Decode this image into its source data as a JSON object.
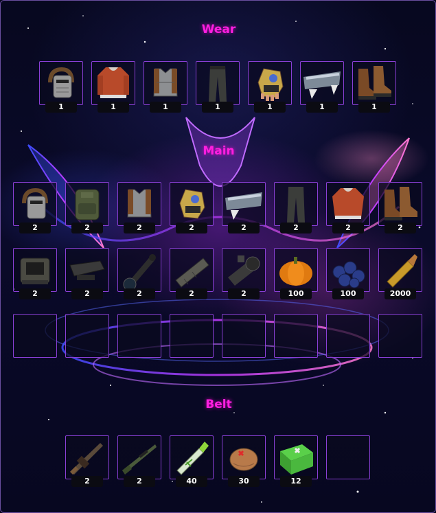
{
  "wear": {
    "title": "Wear",
    "items": [
      {
        "icon": "metal-facemask-icon",
        "qty": "1"
      },
      {
        "icon": "hoodie-icon",
        "qty": "1"
      },
      {
        "icon": "chestplate-icon",
        "qty": "1"
      },
      {
        "icon": "pants-icon",
        "qty": "1"
      },
      {
        "icon": "gloves-icon",
        "qty": "1"
      },
      {
        "icon": "kilt-icon",
        "qty": "1"
      },
      {
        "icon": "boots-icon",
        "qty": "1"
      }
    ]
  },
  "main": {
    "title": "Main",
    "rows": [
      [
        {
          "icon": "metal-facemask-icon",
          "qty": "2"
        },
        {
          "icon": "backpack-icon",
          "qty": "2"
        },
        {
          "icon": "chestplate-icon",
          "qty": "2"
        },
        {
          "icon": "gloves-icon",
          "qty": "2"
        },
        {
          "icon": "kilt-icon",
          "qty": "2"
        },
        {
          "icon": "pants-icon",
          "qty": "2"
        },
        {
          "icon": "hoodie-icon",
          "qty": "2"
        },
        {
          "icon": "boots-icon",
          "qty": "2"
        }
      ],
      [
        {
          "icon": "holosight-icon",
          "qty": "2"
        },
        {
          "icon": "flashlight-attachment-icon",
          "qty": "2"
        },
        {
          "icon": "scope-icon",
          "qty": "2"
        },
        {
          "icon": "silencer-icon",
          "qty": "2"
        },
        {
          "icon": "night-scope-icon",
          "qty": "2"
        },
        {
          "icon": "pumpkin-icon",
          "qty": "100"
        },
        {
          "icon": "blueberries-icon",
          "qty": "100"
        },
        {
          "icon": "rifle-ammo-icon",
          "qty": "2000"
        }
      ],
      [
        {
          "icon": "",
          "qty": ""
        },
        {
          "icon": "",
          "qty": ""
        },
        {
          "icon": "",
          "qty": ""
        },
        {
          "icon": "",
          "qty": ""
        },
        {
          "icon": "",
          "qty": ""
        },
        {
          "icon": "",
          "qty": ""
        },
        {
          "icon": "",
          "qty": ""
        },
        {
          "icon": "",
          "qty": ""
        }
      ]
    ]
  },
  "belt": {
    "title": "Belt",
    "items": [
      {
        "icon": "assault-rifle-icon",
        "qty": "2"
      },
      {
        "icon": "bolt-rifle-icon",
        "qty": "2"
      },
      {
        "icon": "syringe-icon",
        "qty": "40"
      },
      {
        "icon": "bandage-icon",
        "qty": "30"
      },
      {
        "icon": "medkit-icon",
        "qty": "12"
      },
      {
        "icon": "",
        "qty": ""
      }
    ]
  },
  "colors": {
    "accent": "#ff1fe0",
    "slot_border": "#8a3fd6"
  }
}
